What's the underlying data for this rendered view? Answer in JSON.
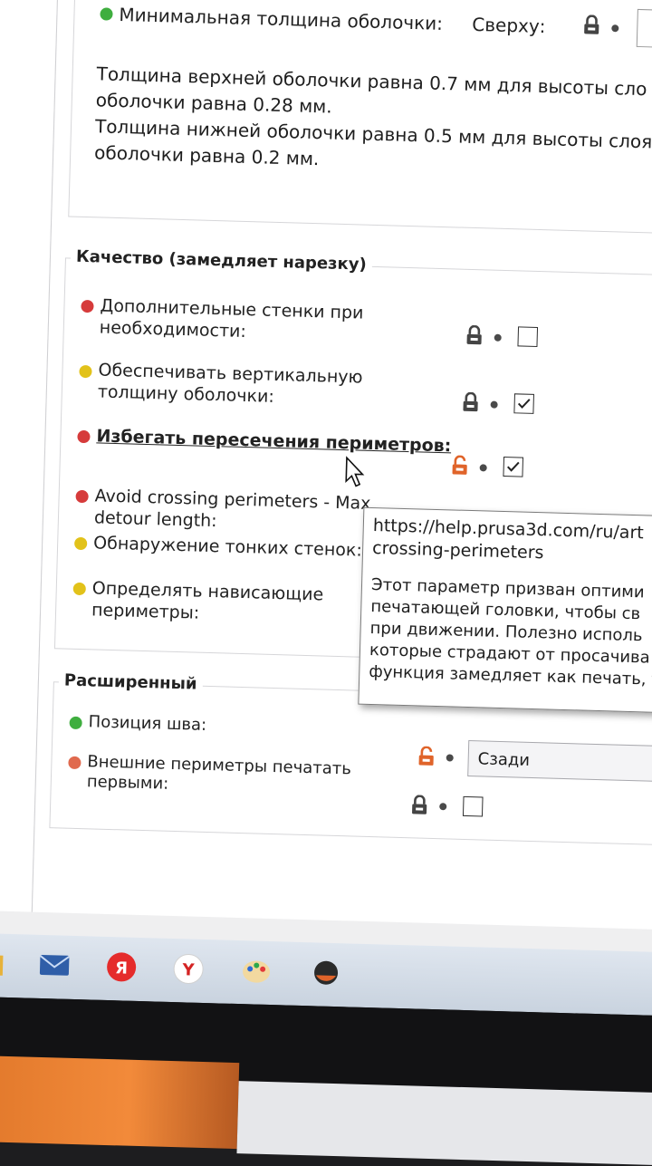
{
  "shell": {
    "label": "Минимальная толщина оболочки:",
    "top_label": "Сверху:",
    "info_line1": "Толщина верхней оболочки равна 0.7 мм для высоты сло",
    "info_line2": "оболочки равна 0.28 мм.",
    "info_line3": "Толщина нижней оболочки равна 0.5 мм для высоты слоя",
    "info_line4": "оболочки равна 0.2 мм."
  },
  "quality": {
    "title": "Качество (замедляет нарезку)",
    "rows": [
      {
        "label_line1": "Дополнительные стенки при",
        "label_line2": "необходимости:",
        "dot_color": "#d63b3b",
        "checked": false,
        "lock": "locked"
      },
      {
        "label_line1": "Обеспечивать вертикальную",
        "label_line2": "толщину оболочки:",
        "dot_color": "#e2c21a",
        "checked": true,
        "lock": "locked"
      },
      {
        "label_line1": "Избегать пересечения периметров:",
        "label_line2": "",
        "dot_color": "#d63b3b",
        "checked": true,
        "lock": "unlocked"
      },
      {
        "label_line1": "Avoid crossing perimeters - Max",
        "label_line2": "detour length:",
        "dot_color": "#d63b3b"
      },
      {
        "label_line1": "Обнаружение тонких стенок:",
        "label_line2": "",
        "dot_color": "#e2c21a"
      },
      {
        "label_line1": "Определять нависающие",
        "label_line2": "периметры:",
        "dot_color": "#e2c21a"
      }
    ]
  },
  "tooltip": {
    "url_line1": "https://help.prusa3d.com/ru/art",
    "url_line2": "crossing-perimeters",
    "text_line1": "Этот параметр призван оптими",
    "text_line2": "печатающей головки, чтобы св",
    "text_line3": "при движении. Полезно исполь",
    "text_line4": "которые страдают от просачива",
    "text_line5": "функция замедляет как печать, т"
  },
  "advanced": {
    "title": "Расширенный",
    "seam_label": "Позиция шва:",
    "seam_value": "Сзади",
    "seam_dot": "#3fae3f",
    "external_label_line1": "Внешние периметры печатать",
    "external_label_line2": "первыми:",
    "external_dot": "#e06a4e",
    "external_checked": false
  },
  "taskbar": {
    "icons": [
      "folder-icon",
      "mail-icon",
      "yandex-icon",
      "yandex-browser-icon",
      "paint-icon",
      "prusa-slicer-icon"
    ]
  },
  "colors": {
    "lock_locked": "#444444",
    "lock_unlocked": "#e0642a",
    "green": "#3fae3f",
    "red": "#d63b3b",
    "yellow": "#e2c21a"
  }
}
